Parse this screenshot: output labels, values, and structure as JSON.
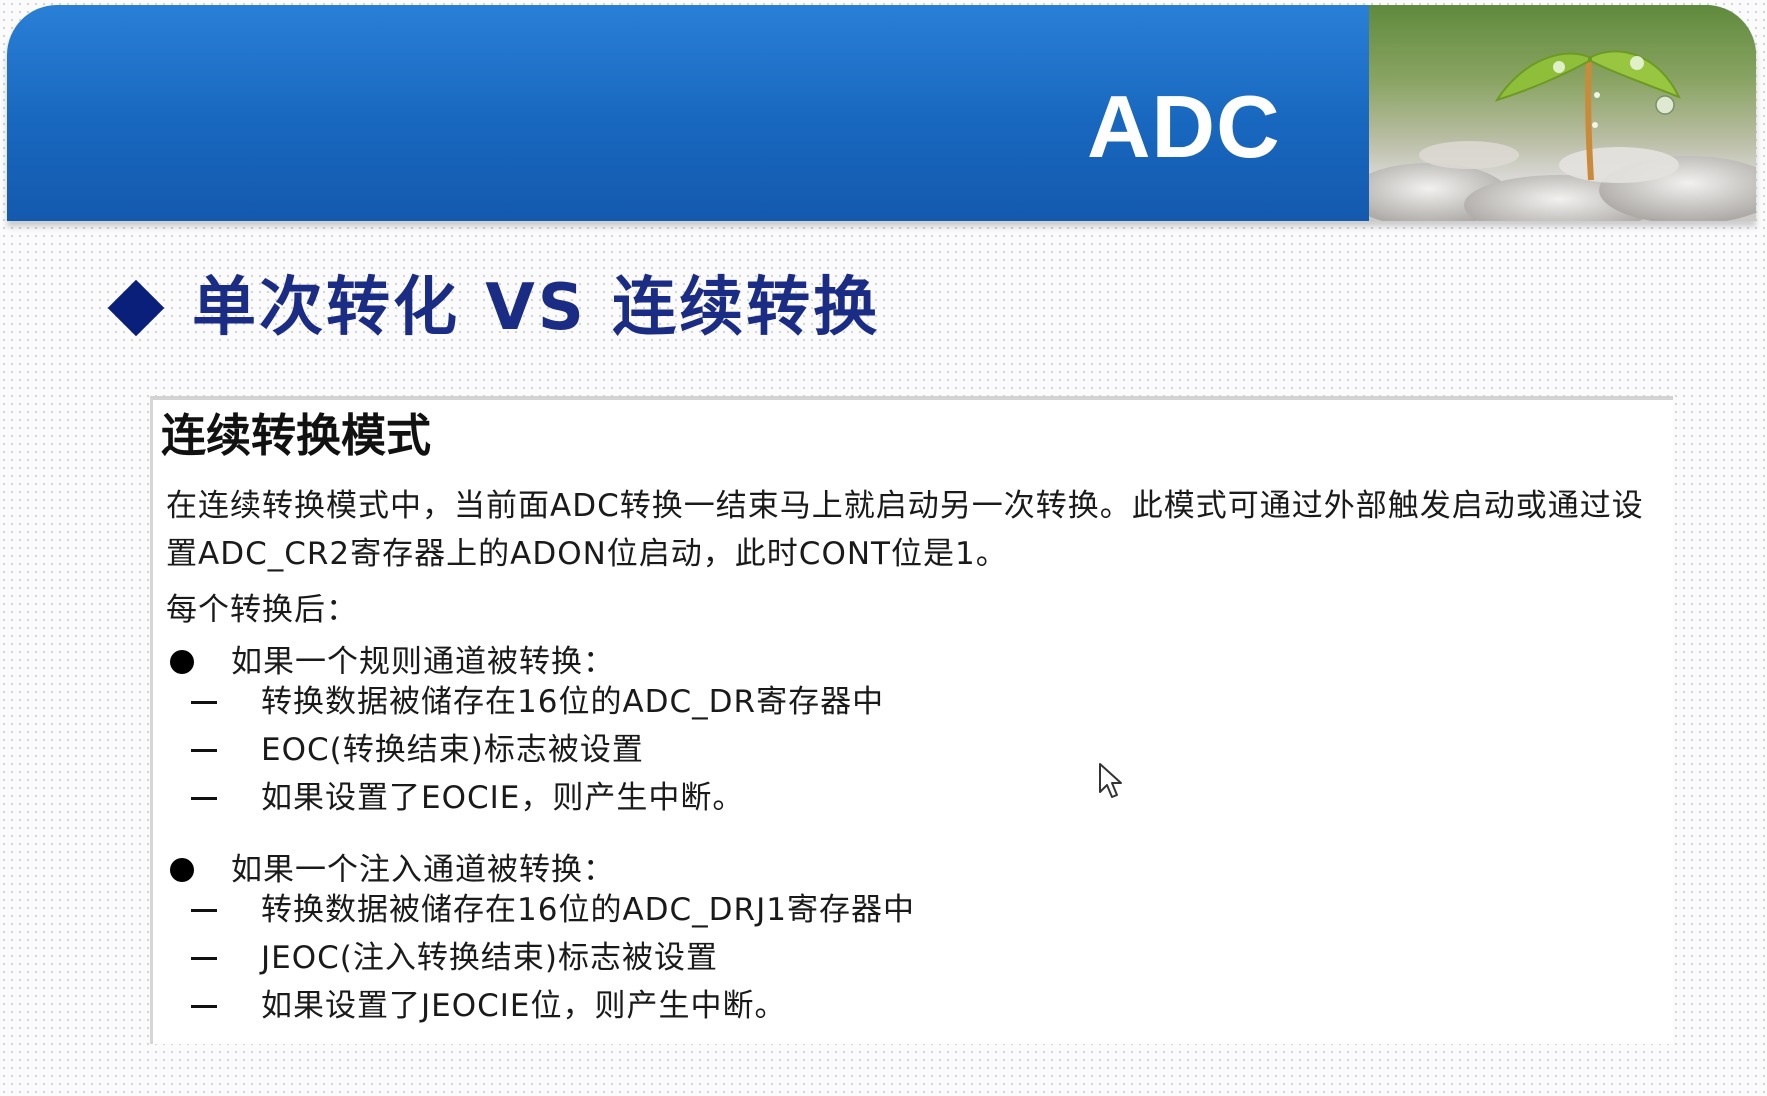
{
  "header": {
    "title": "ADC"
  },
  "slide": {
    "heading": "单次转化 VS 连续转换"
  },
  "panel": {
    "title": "连续转换模式",
    "paragraph": "在连续转换模式中，当前面ADC转换一结束马上就启动另一次转换。此模式可通过外部触发启动或通过设置ADC_CR2寄存器上的ADON位启动，此时CONT位是1。",
    "intro": "每个转换后：",
    "sections": [
      {
        "bullet": "如果一个规则通道被转换：",
        "items": [
          "转换数据被储存在16位的ADC_DR寄存器中",
          "EOC(转换结束)标志被设置",
          "如果设置了EOCIE，则产生中断。"
        ]
      },
      {
        "bullet": "如果一个注入通道被转换：",
        "items": [
          "转换数据被储存在16位的ADC_DRJ1寄存器中",
          "JEOC(注入转换结束)标志被设置",
          "如果设置了JEOCIE位，则产生中断。"
        ]
      }
    ]
  },
  "colors": {
    "header_blue": "#1867bf",
    "heading_navy": "#1a2c83",
    "diamond": "#0a1f7a"
  }
}
